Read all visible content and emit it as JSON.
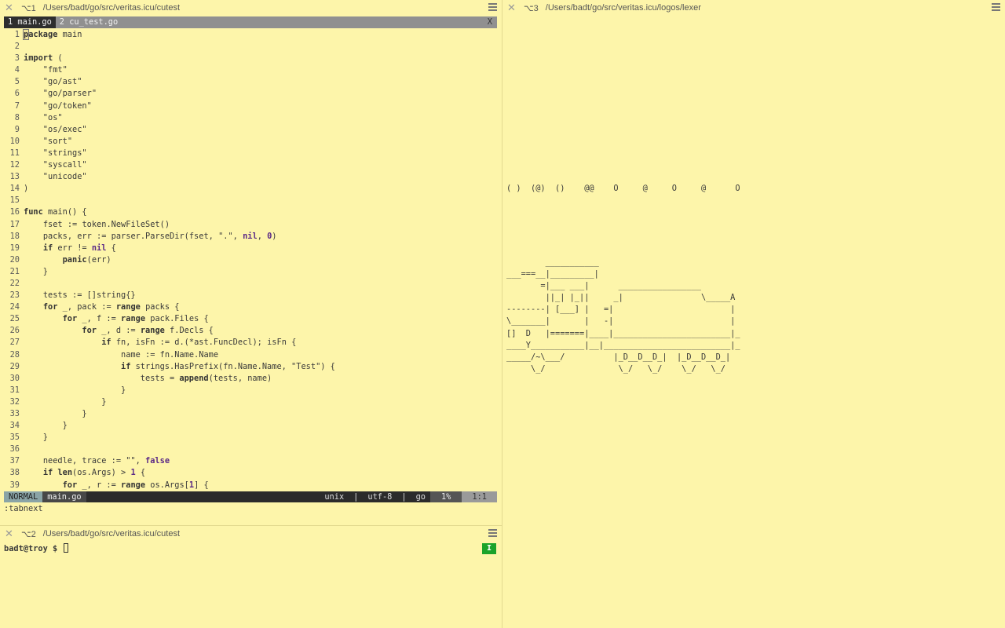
{
  "left_pane": {
    "title": {
      "shortcut": "⌥1",
      "path": "/Users/badt/go/src/veritas.icu/cutest"
    },
    "tabs": [
      {
        "label": "1 main.go",
        "active": true
      },
      {
        "label": "2 cu_test.go",
        "active": false
      }
    ],
    "tab_close": "X",
    "code_lines": [
      "package main",
      "",
      "import (",
      "    \"fmt\"",
      "    \"go/ast\"",
      "    \"go/parser\"",
      "    \"go/token\"",
      "    \"os\"",
      "    \"os/exec\"",
      "    \"sort\"",
      "    \"strings\"",
      "    \"syscall\"",
      "    \"unicode\"",
      ")",
      "",
      "func main() {",
      "    fset := token.NewFileSet()",
      "    packs, err := parser.ParseDir(fset, \".\", nil, 0)",
      "    if err != nil {",
      "        panic(err)",
      "    }",
      "",
      "    tests := []string{}",
      "    for _, pack := range packs {",
      "        for _, f := range pack.Files {",
      "            for _, d := range f.Decls {",
      "                if fn, isFn := d.(*ast.FuncDecl); isFn {",
      "                    name := fn.Name.Name",
      "                    if strings.HasPrefix(fn.Name.Name, \"Test\") {",
      "                        tests = append(tests, name)",
      "                    }",
      "                }",
      "            }",
      "        }",
      "    }",
      "",
      "    needle, trace := \"\", false",
      "    if len(os.Args) > 1 {",
      "        for _, r := range os.Args[1] {"
    ],
    "status": {
      "mode": "NORMAL",
      "file": "main.go",
      "format": "unix",
      "encoding": "utf-8",
      "filetype": "go",
      "percent": "1%",
      "position": "1:1",
      "sep": "|"
    },
    "command_line": ":tabnext"
  },
  "bottom_pane": {
    "title": {
      "shortcut": "⌥2",
      "path": "/Users/badt/go/src/veritas.icu/cutest"
    },
    "prompt": "badt@troy $",
    "mode_badge": "I"
  },
  "right_pane": {
    "title": {
      "shortcut": "⌥3",
      "path": "/Users/badt/go/src/veritas.icu/logos/lexer"
    },
    "smoke": "( )  (@)  ()    @@    O     @     O     @      O",
    "train": "        ___________\n___===__|_________|\n       =|___ ___|      _________________\n        ||_| |_||     _|                \\_____A\n--------| [___] |   =|                        |\n\\_______|       |   -|                        |\n[]  D   |=======|____|________________________|_\n____Y___________|__|__________________________|_\n_____/~\\___/          |_D__D__D_|  |_D__D__D_|\n     \\_/               \\_/   \\_/    \\_/   \\_/"
  }
}
